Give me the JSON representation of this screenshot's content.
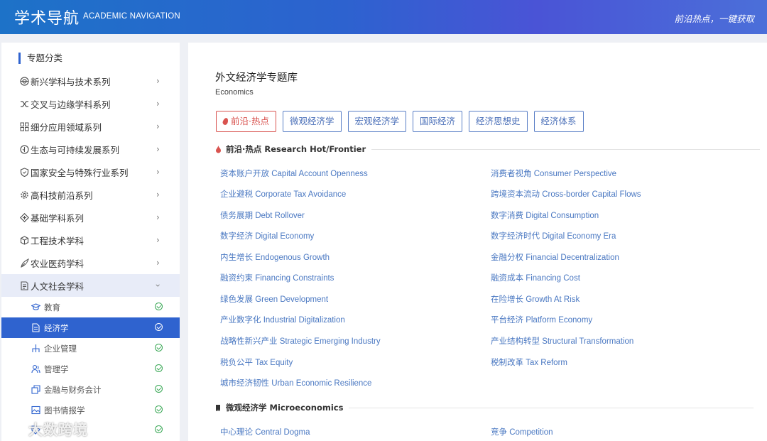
{
  "header": {
    "logo": "学术导航",
    "logo_en": "ACADEMIC NAVIGATION",
    "slogan": "前沿热点，一键获取"
  },
  "sidebar": {
    "title": "专题分类",
    "items": [
      {
        "label": "新兴学科与技术系列",
        "icon": "atom-icon"
      },
      {
        "label": "交叉与边缘学科系列",
        "icon": "shuffle-icon"
      },
      {
        "label": "细分应用领域系列",
        "icon": "grid-icon"
      },
      {
        "label": "生态与可持续发展系列",
        "icon": "leaf-icon"
      },
      {
        "label": "国家安全与特殊行业系列",
        "icon": "shield-icon"
      },
      {
        "label": "高科技前沿系列",
        "icon": "gear-icon"
      },
      {
        "label": "基础学科系列",
        "icon": "plus-icon"
      },
      {
        "label": "工程技术学科",
        "icon": "cube-icon"
      },
      {
        "label": "农业医药学科",
        "icon": "plant-icon"
      },
      {
        "label": "人文社会学科",
        "icon": "book-icon"
      }
    ],
    "subitems": [
      {
        "label": "教育",
        "icon": "graduation-cap-icon"
      },
      {
        "label": "经济学",
        "icon": "document-icon"
      },
      {
        "label": "企业管理",
        "icon": "org-chart-icon"
      },
      {
        "label": "管理学",
        "icon": "users-icon"
      },
      {
        "label": "金融与财务会计",
        "icon": "stack-icon"
      },
      {
        "label": "图书情报学",
        "icon": "image-icon"
      },
      {
        "label": "",
        "icon": "tag-icon"
      }
    ]
  },
  "main": {
    "title": "外文经济学专题库",
    "subtitle": "Economics",
    "tabs": [
      "前沿·热点",
      "微观经济学",
      "宏观经济学",
      "国际经济",
      "经济思想史",
      "经济体系"
    ],
    "sections": [
      {
        "title": "前沿·热点 Research Hot/Frontier",
        "links_left": [
          "资本账户开放 Capital Account Openness",
          "企业避税 Corporate Tax Avoidance",
          "债务展期 Debt Rollover",
          "数字经济 Digital Economy",
          "内生增长 Endogenous Growth",
          "融资约束 Financing Constraints",
          "绿色发展 Green Development",
          "产业数字化 Industrial Digitalization",
          "战略性新兴产业 Strategic Emerging Industry",
          "税负公平 Tax Equity",
          "城市经济韧性 Urban Economic Resilience"
        ],
        "links_right": [
          "消费者视角 Consumer Perspective",
          "跨境资本流动 Cross-border Capital Flows",
          "数字消费 Digital Consumption",
          "数字经济时代 Digital Economy Era",
          "金融分权 Financial Decentralization",
          "融资成本 Financing Cost",
          "在险增长 Growth At Risk",
          "平台经济 Platform Economy",
          "产业结构转型 Structural Transformation",
          "税制改革 Tax Reform"
        ]
      },
      {
        "title": "微观经济学 Microeconomics",
        "links_left": [
          "中心理论 Central Dogma"
        ],
        "links_right": [
          "竞争 Competition"
        ]
      }
    ]
  },
  "watermark": "大数跨境",
  "colors": {
    "primary": "#2f63cf",
    "link": "#4a78c2",
    "hot": "#d9534f",
    "check": "#3aa856"
  }
}
